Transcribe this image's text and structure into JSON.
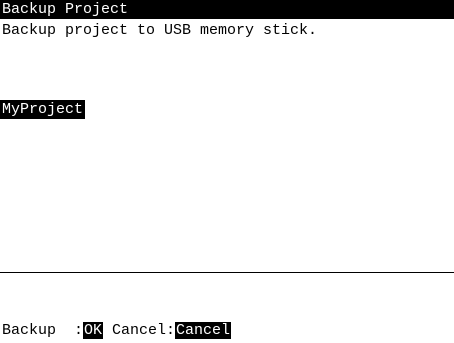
{
  "dialog": {
    "title": "Backup Project",
    "description": "Backup project to USB memory stick."
  },
  "project_list": {
    "items": [
      {
        "label": "MyProject",
        "selected": true
      }
    ]
  },
  "footer": {
    "backup_label": "Backup  :",
    "ok_button": "OK",
    "cancel_label": " Cancel:",
    "cancel_button": "Cancel"
  },
  "colors": {
    "background": "#ffffff",
    "foreground": "#000000",
    "highlight": "#000000",
    "highlight_text": "#ffffff"
  }
}
